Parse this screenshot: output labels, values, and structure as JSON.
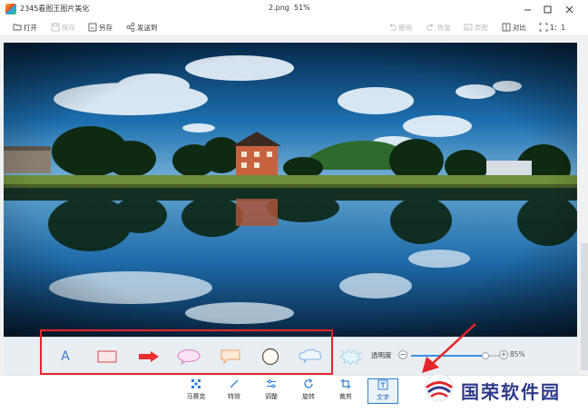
{
  "window": {
    "app_title": "2345看图王图片美化",
    "doc_title": "2.png",
    "zoom": "51%"
  },
  "toolbar": {
    "open": "打开",
    "save": "保存",
    "save_as": "另存",
    "send_to": "发送到",
    "undo": "撤销",
    "redo": "恢复",
    "original": "原图",
    "compare": "对比",
    "ratio": "1：1"
  },
  "text_tools": {
    "text_glyph": "A",
    "opacity_label": "透明度",
    "opacity_value": "85%",
    "opacity_fraction": 0.85
  },
  "bottombar": {
    "items": [
      {
        "label": "马赛克",
        "icon": "mosaic-icon"
      },
      {
        "label": "特效",
        "icon": "magic-wand-icon"
      },
      {
        "label": "调整",
        "icon": "sliders-icon"
      },
      {
        "label": "旋转",
        "icon": "rotate-icon"
      },
      {
        "label": "裁剪",
        "icon": "crop-icon"
      },
      {
        "label": "文字",
        "icon": "text-icon"
      }
    ]
  },
  "watermark": {
    "text": "国荣软件园"
  },
  "colors": {
    "highlight": "#e3262a",
    "accent": "#2a7fd4",
    "watermark": "#2f3a8c"
  }
}
